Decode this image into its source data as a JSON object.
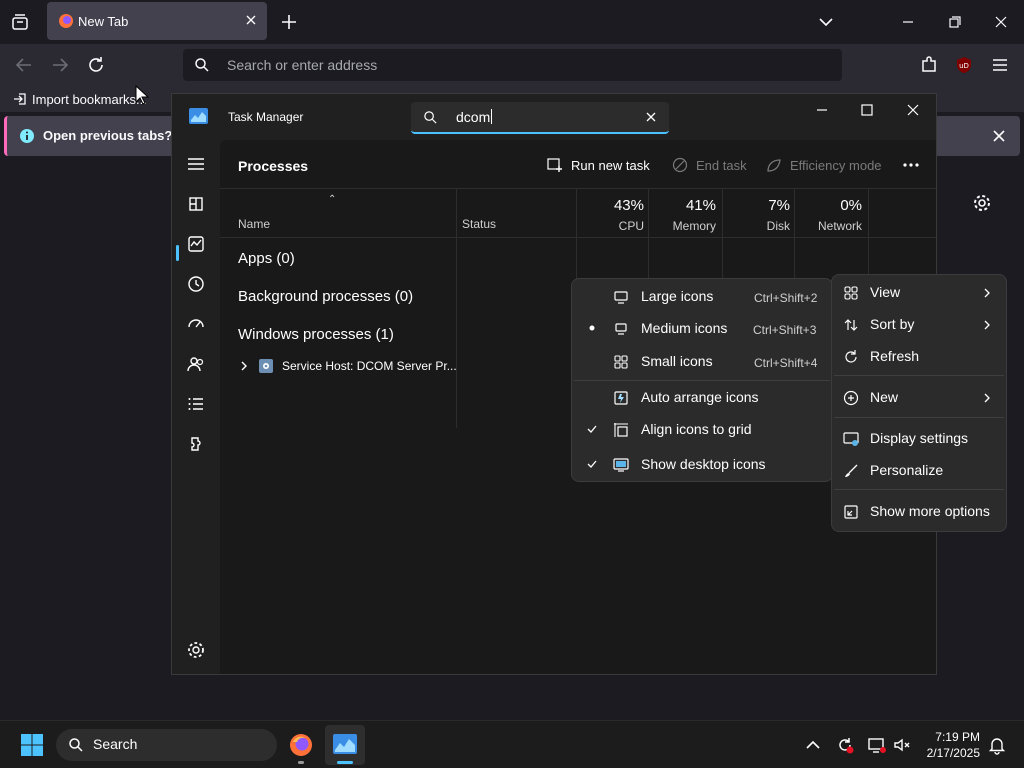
{
  "browser": {
    "tab_title": "New Tab",
    "url_placeholder": "Search or enter address",
    "bookmark_import": "Import bookmarks...",
    "notice_text": "Open previous tabs? You",
    "colors": {
      "bg": "#1c1b22",
      "toolbar": "#2b2a33",
      "accent": "#ff6bba"
    }
  },
  "task_manager": {
    "title": "Task Manager",
    "search_value": "dcom",
    "section_title": "Processes",
    "commands": {
      "run_new_task": "Run new task",
      "end_task": "End task",
      "efficiency_mode": "Efficiency mode"
    },
    "columns": {
      "name": "Name",
      "status": "Status",
      "cpu_pct": "43%",
      "cpu": "CPU",
      "memory_pct": "41%",
      "memory": "Memory",
      "disk_pct": "7%",
      "disk": "Disk",
      "network_pct": "0%",
      "network": "Network"
    },
    "groups": {
      "apps": "Apps (0)",
      "background": "Background processes (0)",
      "windows": "Windows processes (1)"
    },
    "process_name": "Service Host: DCOM Server Pr...",
    "accent": "#4cc2ff"
  },
  "view_submenu": {
    "items": [
      {
        "label": "Large icons",
        "shortcut": "Ctrl+Shift+2",
        "icon": "monitor-large-icon",
        "marker": ""
      },
      {
        "label": "Medium icons",
        "shortcut": "Ctrl+Shift+3",
        "icon": "monitor-medium-icon",
        "marker": "dot"
      },
      {
        "label": "Small icons",
        "shortcut": "Ctrl+Shift+4",
        "icon": "grid-small-icon",
        "marker": ""
      },
      {
        "label": "Auto arrange icons",
        "shortcut": "",
        "icon": "auto-arrange-icon",
        "marker": ""
      },
      {
        "label": "Align icons to grid",
        "shortcut": "",
        "icon": "align-grid-icon",
        "marker": "check"
      },
      {
        "label": "Show desktop icons",
        "shortcut": "",
        "icon": "desktop-icons-icon",
        "marker": "check"
      }
    ]
  },
  "context_menu": {
    "view": "View",
    "sort_by": "Sort by",
    "refresh": "Refresh",
    "new": "New",
    "display_settings": "Display settings",
    "personalize": "Personalize",
    "show_more_options": "Show more options"
  },
  "taskbar": {
    "search_label": "Search",
    "time": "7:19 PM",
    "date": "2/17/2025"
  }
}
